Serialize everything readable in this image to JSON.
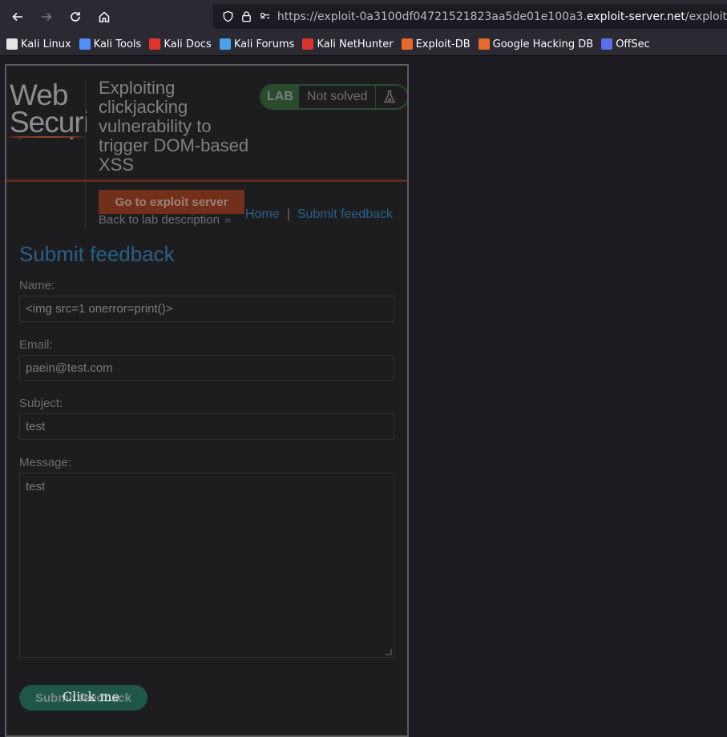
{
  "browser": {
    "url_prefix": "https://exploit-0a3100df04721521823aa5de01e100a3.",
    "url_domain": "exploit-server.net",
    "url_path": "/exploit",
    "bookmarks": [
      {
        "label": "Kali Linux",
        "icon": "kali-dragon-icon",
        "color": "#e6e6e6"
      },
      {
        "label": "Kali Tools",
        "icon": "kali-tools-icon",
        "color": "#4f8ff7"
      },
      {
        "label": "Kali Docs",
        "icon": "kali-docs-icon",
        "color": "#e0342b"
      },
      {
        "label": "Kali Forums",
        "icon": "kali-forums-icon",
        "color": "#4aa3e8"
      },
      {
        "label": "Kali NetHunter",
        "icon": "nethunter-icon",
        "color": "#d9342b"
      },
      {
        "label": "Exploit-DB",
        "icon": "exploit-db-icon",
        "color": "#e56a2b"
      },
      {
        "label": "Google Hacking DB",
        "icon": "ghdb-icon",
        "color": "#e56a2b"
      },
      {
        "label": "OffSec",
        "icon": "offsec-icon",
        "color": "#5a6ee8"
      }
    ]
  },
  "lab": {
    "logo_text": "Web Security Academy",
    "title": "Exploiting clickjacking vulnerability to trigger DOM-based XSS",
    "badge_label": "LAB",
    "status": "Not solved",
    "exploit_button": "Go to exploit server",
    "back_link": "Back to lab description",
    "nav_home": "Home",
    "nav_separator": "|",
    "nav_feedback": "Submit feedback"
  },
  "form": {
    "title": "Submit feedback",
    "name_label": "Name:",
    "name_value": "<img src=1 onerror=print()>",
    "email_label": "Email:",
    "email_value": "paein@test.com",
    "subject_label": "Subject:",
    "subject_value": "test",
    "message_label": "Message:",
    "message_value": "test",
    "submit_label": "Submit feedback"
  },
  "decoy": {
    "label": "Click me"
  },
  "colors": {
    "accent_blue": "#2e7ab0",
    "exploit_orange": "#933717",
    "submit_green": "#1f6e58",
    "lab_green": "#2f5d35"
  }
}
